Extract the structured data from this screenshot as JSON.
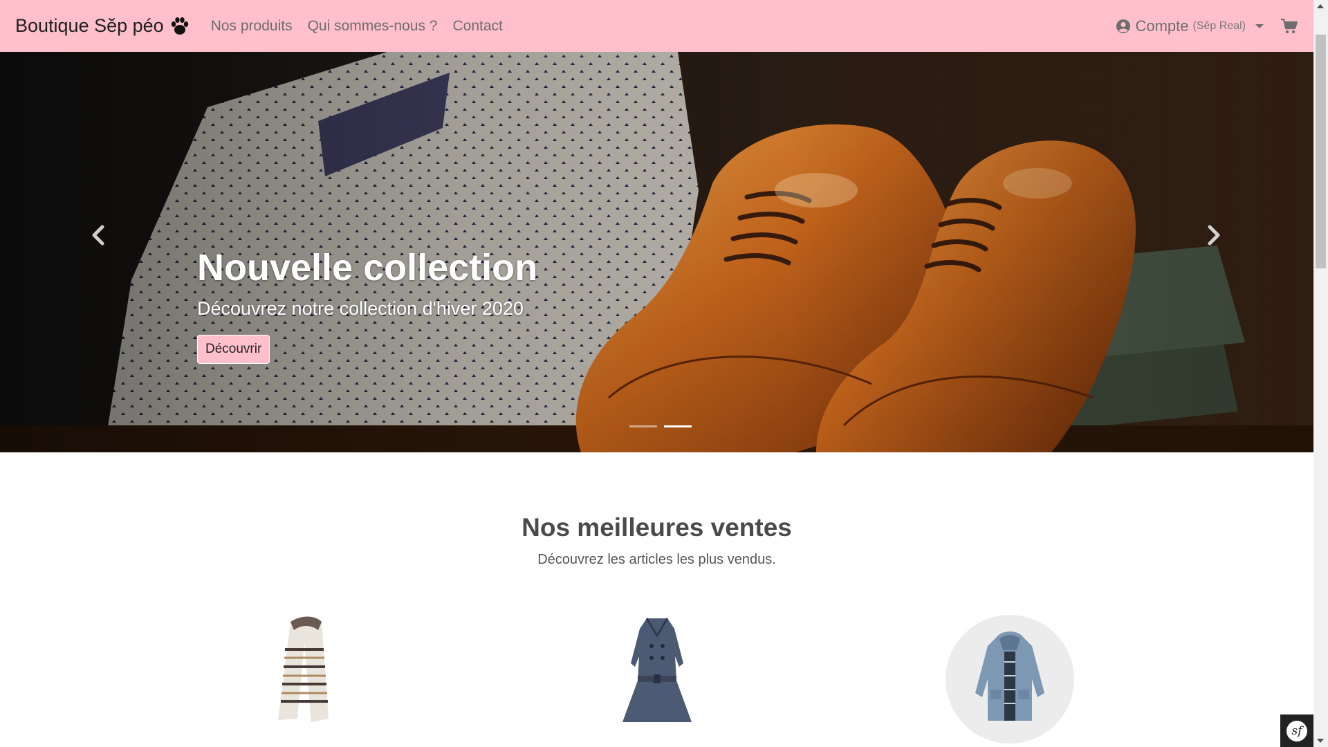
{
  "navbar": {
    "brand": "Boutique Sĕp péo",
    "brand_icon": "paw-icon",
    "links": [
      {
        "label": "Nos produits"
      },
      {
        "label": "Qui sommes-nous ?"
      },
      {
        "label": "Contact"
      }
    ],
    "account": {
      "label": "Compte",
      "user": "(Sĕp Real)",
      "icon": "user-circle-icon"
    },
    "cart_icon": "shopping-cart-icon",
    "background_color": "#ffc0cb"
  },
  "hero": {
    "title": "Nouvelle collection",
    "subtitle": "Découvrez notre collection d'hiver 2020",
    "button_label": "Découvrir",
    "button_color": "#ffc0cb",
    "prev_icon": "chevron-left-icon",
    "next_icon": "chevron-right-icon",
    "slide_count": 2,
    "active_slide": 2
  },
  "bestsellers": {
    "title": "Nos meilleures ventes",
    "subtitle": "Découvrez les articles les plus vendus.",
    "products": [
      {
        "image": "scarf"
      },
      {
        "image": "coat"
      },
      {
        "image": "jacket"
      }
    ]
  },
  "debug_toolbar": {
    "icon": "symfony-icon",
    "glyph": "sf"
  }
}
